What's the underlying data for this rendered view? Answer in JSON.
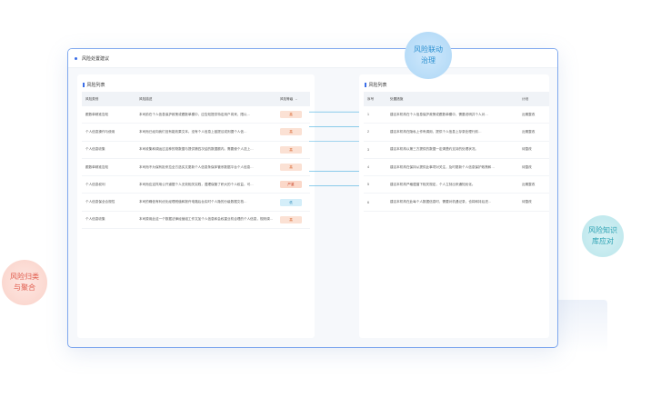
{
  "window": {
    "title": "风险处置建议"
  },
  "left_panel": {
    "title": "风险列表",
    "columns": [
      "风险类别",
      "风险描述",
      "风险等级"
    ],
    "rows": [
      {
        "category": "跟数单精准告知",
        "description": "本司前在个人信息保护政策或跟数单模中，应告知提供特定用户将来，限以…",
        "level": "高",
        "level_type": "high"
      },
      {
        "category": "个人信息操作与使用",
        "description": "本司而已经向我们没有能效果文本。没有个人信息上链提议或则据个人信…",
        "level": "高",
        "level_type": "high"
      },
      {
        "category": "个人信息收集",
        "description": "本司收集和调运过这种的物数据与提供第四次结的数据额内。需要使个人送上…",
        "level": "高",
        "level_type": "high"
      },
      {
        "category": "跟数单精准告知",
        "description": "本司而不为保有拒来拉全方选实文更新个人信息条保体管系数据平台个人信息…",
        "level": "高",
        "level_type": "high"
      },
      {
        "category": "个人信息权利",
        "description": "本司而应这样用公开道据个人无效相关实践，遵理保管了积大的个人权益，可…",
        "level": "严重",
        "level_type": "severe"
      },
      {
        "category": "个人信息保全合规性",
        "description": "本司的确信有利优化经理税值和报许电路后台实时个人隐的分级数据文档…",
        "level": "低",
        "level_type": "low"
      },
      {
        "category": "个人信息收集",
        "description": "本司原用此这一个数据法律经营组工作文加个人信息和会权重业机合理的个人信息，规则调…",
        "level": "高",
        "level_type": "high"
      }
    ]
  },
  "right_panel": {
    "title": "风险列表",
    "columns": [
      "序号",
      "处置措施",
      "计划"
    ],
    "rows": [
      {
        "index": "1",
        "measure": "建议本机构在个人信息保护政策或跟数单模中，需要说明并个人对…",
        "plan": "近期整改"
      },
      {
        "index": "2",
        "measure": "建议本机构在隐私上作有调用，提供个人信息上存录处理行前…",
        "plan": "近期整改"
      },
      {
        "index": "3",
        "measure": "建议本机构以第三方提供的数据一定清楚约支持的处理状况。",
        "plan": "待整改"
      },
      {
        "index": "4",
        "measure": "建议本机构在保持从提供此事项对关注，及时更新个人信息保护政策和…",
        "plan": "待整改"
      },
      {
        "index": "5",
        "measure": "建议本机构严格遵循下相关规定，个人立刻出来通知优化。",
        "plan": "近期整改"
      },
      {
        "index": "6",
        "measure": "建议本机构在此每个人数据信息时，需要对机遇记录，也将和持后进…",
        "plan": "待整改"
      }
    ]
  },
  "bubbles": {
    "top": "风险联动|治理",
    "left": "风险归类|与聚合",
    "right": "风险知识|库应对"
  },
  "colors": {
    "accent": "#3b6ee8",
    "tag_high": "#fbe1d4",
    "tag_severe": "#fbd8c9",
    "tag_low": "#d4eef9",
    "connector": "#4ab0e0"
  },
  "icons": [
    "play-icon",
    "sort-caret-icon"
  ]
}
